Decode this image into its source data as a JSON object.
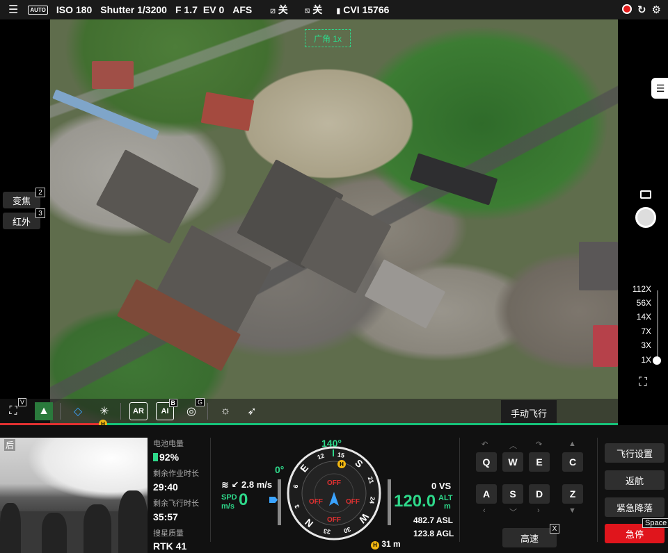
{
  "top_bar": {
    "auto_label": "AUTO",
    "iso": "ISO 180",
    "shutter": "Shutter 1/3200",
    "aperture": "F 1.7",
    "ev": "EV 0",
    "focus": "AFS",
    "option1": "关",
    "option2": "关",
    "storage": "CVI 15766"
  },
  "camera": {
    "target_label": "广角 1x"
  },
  "left_panel": {
    "zoom_mode": {
      "label": "变焦",
      "key": "2"
    },
    "ir_mode": {
      "label": "红外",
      "key": "3"
    }
  },
  "right_panel": {
    "zoom_levels": [
      "112X",
      "56X",
      "14X",
      "7X",
      "3X",
      "1X"
    ],
    "current_zoom_fraction": 0
  },
  "toolbar": {
    "fit_badge": "V",
    "ai_badge": "B",
    "target_badge": "G",
    "ar_label": "AR",
    "ai_label": "AI"
  },
  "flight_mode_tab": "手动飞行",
  "pip": {
    "label": "后"
  },
  "stats": {
    "battery_label": "电池电量",
    "battery_value": "92%",
    "work_time_label": "剩余作业时长",
    "work_time_value": "29:40",
    "flight_time_label": "剩余飞行时长",
    "flight_time_value": "35:57",
    "satellite_label": "搜星质量",
    "satellite_value": "RTK 41"
  },
  "instruments": {
    "heading": "140°",
    "pitch": "0°",
    "wind": "2.8 m/s",
    "spd_label": "SPD",
    "spd_unit": "m/s",
    "spd_value": "0",
    "vs": "0 VS",
    "alt_value": "120.0",
    "alt_label": "ALT",
    "alt_unit": "m",
    "asl": "482.7 ASL",
    "agl": "123.8 AGL",
    "home_distance": "31 m",
    "obstacle_labels": [
      "OFF",
      "OFF",
      "OFF",
      "OFF"
    ],
    "compass": [
      "N",
      "3",
      "6",
      "E",
      "12",
      "15",
      "S",
      "21",
      "24",
      "W",
      "30",
      "33"
    ]
  },
  "keys": {
    "row1": [
      "Q",
      "W",
      "E",
      "C"
    ],
    "row2": [
      "A",
      "S",
      "D",
      "Z"
    ],
    "speed_label": "高速",
    "speed_key": "X"
  },
  "side_buttons": {
    "settings": "飞行设置",
    "return": "返航",
    "emergency_land": "紧急降落",
    "emergency_stop": "急停",
    "stop_key": "Space"
  },
  "colors": {
    "accent_green": "#2ed88a",
    "stop_red": "#e0151c",
    "home_yellow": "#f2b711"
  }
}
